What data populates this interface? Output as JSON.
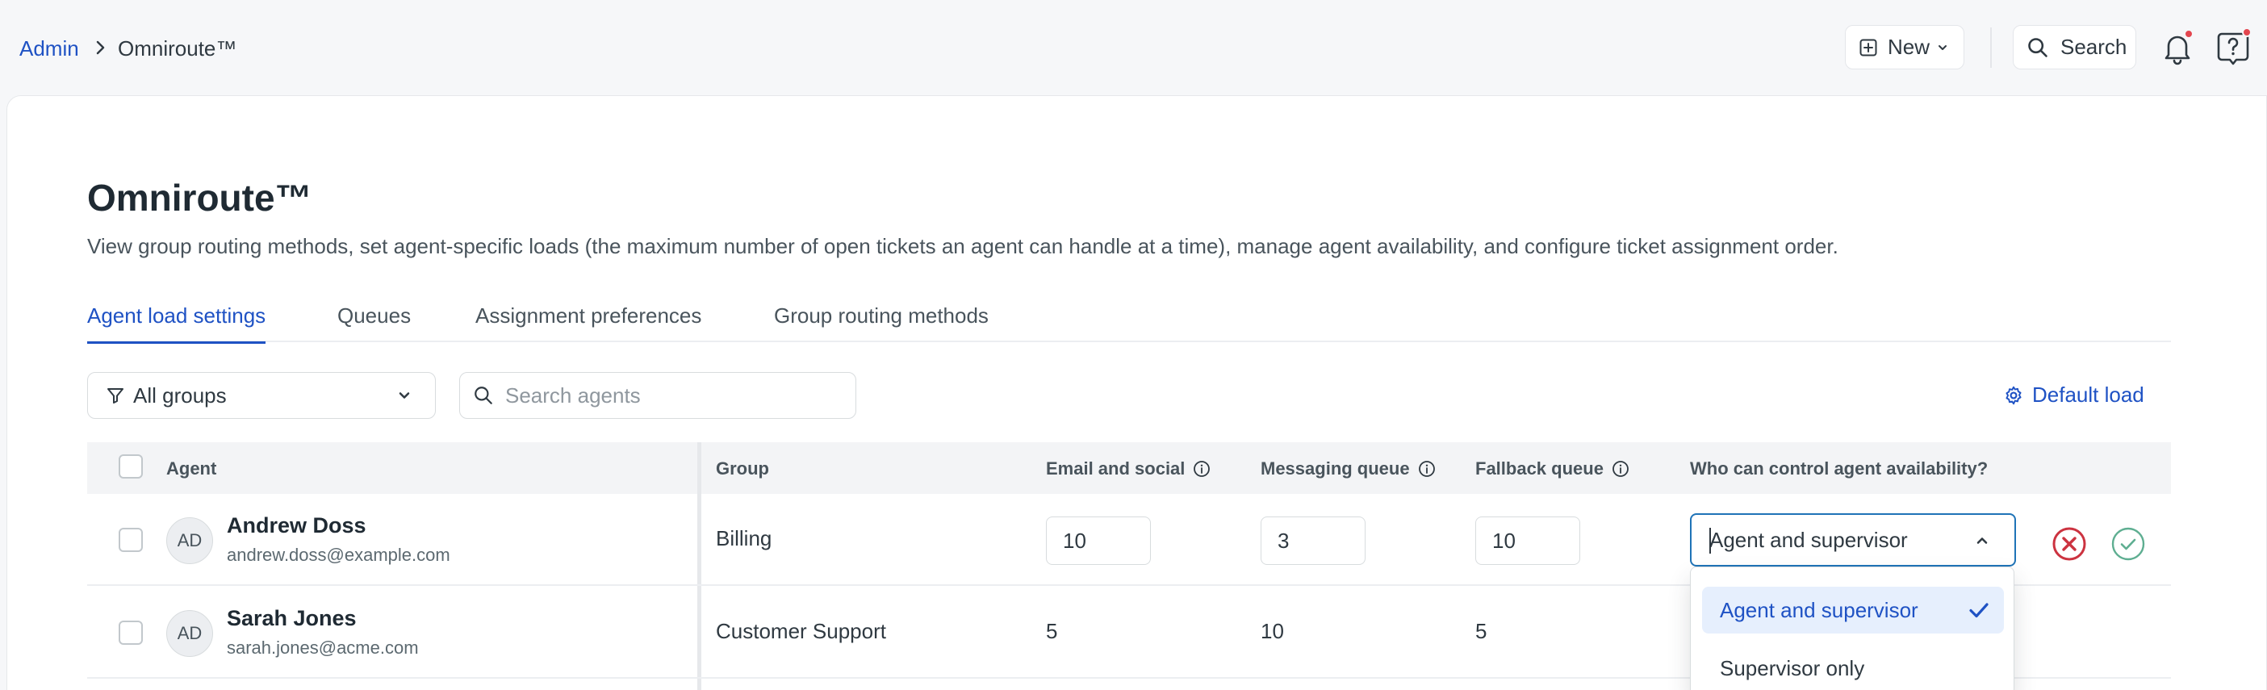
{
  "breadcrumb": {
    "parent": "Admin",
    "current": "Omniroute™"
  },
  "toolbar": {
    "new_label": "New",
    "search_label": "Search"
  },
  "page": {
    "title": "Omniroute™",
    "description": "View group routing methods, set agent-specific loads (the maximum number of open tickets an agent can handle at a time), manage agent availability, and configure ticket assignment order."
  },
  "tabs": [
    {
      "label": "Agent load settings",
      "active": true
    },
    {
      "label": "Queues",
      "active": false
    },
    {
      "label": "Assignment preferences",
      "active": false
    },
    {
      "label": "Group routing methods",
      "active": false
    }
  ],
  "filters": {
    "group_filter": "All groups",
    "search_placeholder": "Search agents",
    "default_load_label": "Default load"
  },
  "table": {
    "columns": {
      "agent": "Agent",
      "group": "Group",
      "email_social": "Email and social",
      "messaging": "Messaging queue",
      "fallback": "Fallback queue",
      "availability": "Who can control agent availability?"
    },
    "rows": [
      {
        "initials": "AD",
        "name": "Andrew Doss",
        "email": "andrew.doss@example.com",
        "group": "Billing",
        "email_social": "10",
        "messaging": "3",
        "fallback": "10",
        "availability": "Agent and supervisor"
      },
      {
        "initials": "AD",
        "name": "Sarah Jones",
        "email": "sarah.jones@acme.com",
        "group": "Customer Support",
        "email_social": "5",
        "messaging": "10",
        "fallback": "5"
      }
    ]
  },
  "dropdown": {
    "options": [
      "Agent and supervisor",
      "Supervisor only"
    ],
    "selected": "Agent and supervisor"
  },
  "colors": {
    "accent": "#1f52c4",
    "focus_border": "#1f73b7",
    "cancel": "#cc3340",
    "confirm": "#5eae91",
    "notification_dot": "#e3464f"
  },
  "icons": [
    "chevron-right-icon",
    "plus-square-icon",
    "chevron-down-icon",
    "search-icon",
    "bell-icon",
    "help-icon",
    "filter-icon",
    "gear-icon",
    "info-icon",
    "chevron-up-icon",
    "x-circle-icon",
    "check-circle-icon",
    "check-icon"
  ]
}
